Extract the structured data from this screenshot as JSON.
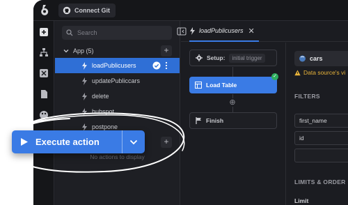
{
  "topbar": {
    "git_label": "Connect Git"
  },
  "sidebar": {
    "search_placeholder": "Search"
  },
  "app_group": {
    "label": "App (5)",
    "queries": [
      {
        "label": "loadPublicusers",
        "selected": true
      },
      {
        "label": "updatePubliccars"
      },
      {
        "label": "delete"
      },
      {
        "label": "hubspot"
      },
      {
        "label": "postpone"
      }
    ],
    "empty_text": "No actions to display"
  },
  "tab": {
    "label": "loadPublicusers"
  },
  "flow": {
    "setup_label": "Setup:",
    "setup_chip": "initial trigger",
    "load_label": "Load Table",
    "finish_label": "Finish"
  },
  "properties": {
    "datasource": "cars",
    "warning": "Data source's vi",
    "filters_header": "FILTERS",
    "filter_fields": [
      "first_name",
      "id",
      ""
    ],
    "limits_header": "LIMITS & ORDER",
    "limit_label": "Limit"
  },
  "execute_button": {
    "label": "Execute action"
  },
  "colors": {
    "accent": "#3a7be5",
    "success": "#2eae5f",
    "warning": "#e9b43a",
    "background": "#1b1c21"
  }
}
